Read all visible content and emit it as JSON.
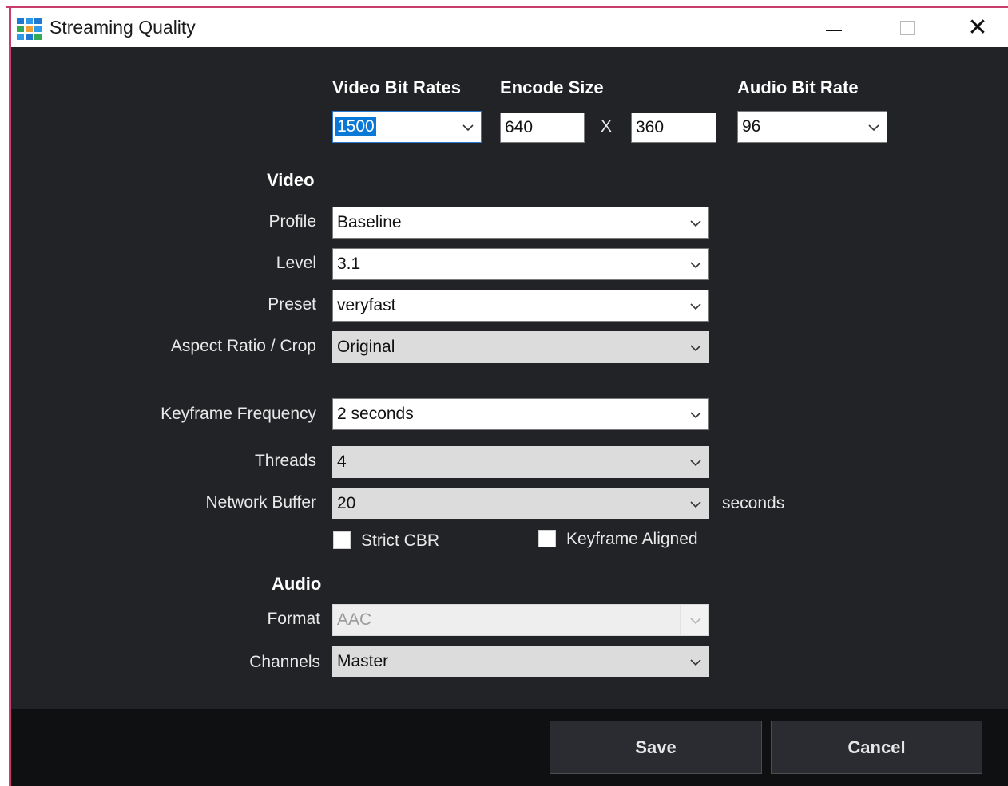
{
  "window": {
    "title": "Streaming Quality"
  },
  "top": {
    "video_bit_rates_label": "Video Bit Rates",
    "video_bit_rate_value": "1500",
    "encode_size_label": "Encode Size",
    "encode_width": "640",
    "encode_separator": "X",
    "encode_height": "360",
    "audio_bit_rate_label": "Audio Bit Rate",
    "audio_bit_rate_value": "96"
  },
  "video": {
    "section_label": "Video",
    "profile_label": "Profile",
    "profile_value": "Baseline",
    "level_label": "Level",
    "level_value": "3.1",
    "preset_label": "Preset",
    "preset_value": "veryfast",
    "aspect_label": "Aspect Ratio / Crop",
    "aspect_value": "Original",
    "keyframe_label": "Keyframe Frequency",
    "keyframe_value": "2 seconds",
    "threads_label": "Threads",
    "threads_value": "4",
    "buffer_label": "Network Buffer",
    "buffer_value": "20",
    "buffer_unit": "seconds",
    "strict_cbr_label": "Strict CBR",
    "strict_cbr_checked": false,
    "keyframe_aligned_label": "Keyframe Aligned",
    "keyframe_aligned_checked": false
  },
  "audio": {
    "section_label": "Audio",
    "format_label": "Format",
    "format_value": "AAC",
    "channels_label": "Channels",
    "channels_value": "Master"
  },
  "footer": {
    "save_label": "Save",
    "cancel_label": "Cancel"
  },
  "colors": {
    "accent": "#c83c6e",
    "panel_bg": "#222326",
    "footer_bg": "#0f1012",
    "selection": "#0a78d7"
  }
}
